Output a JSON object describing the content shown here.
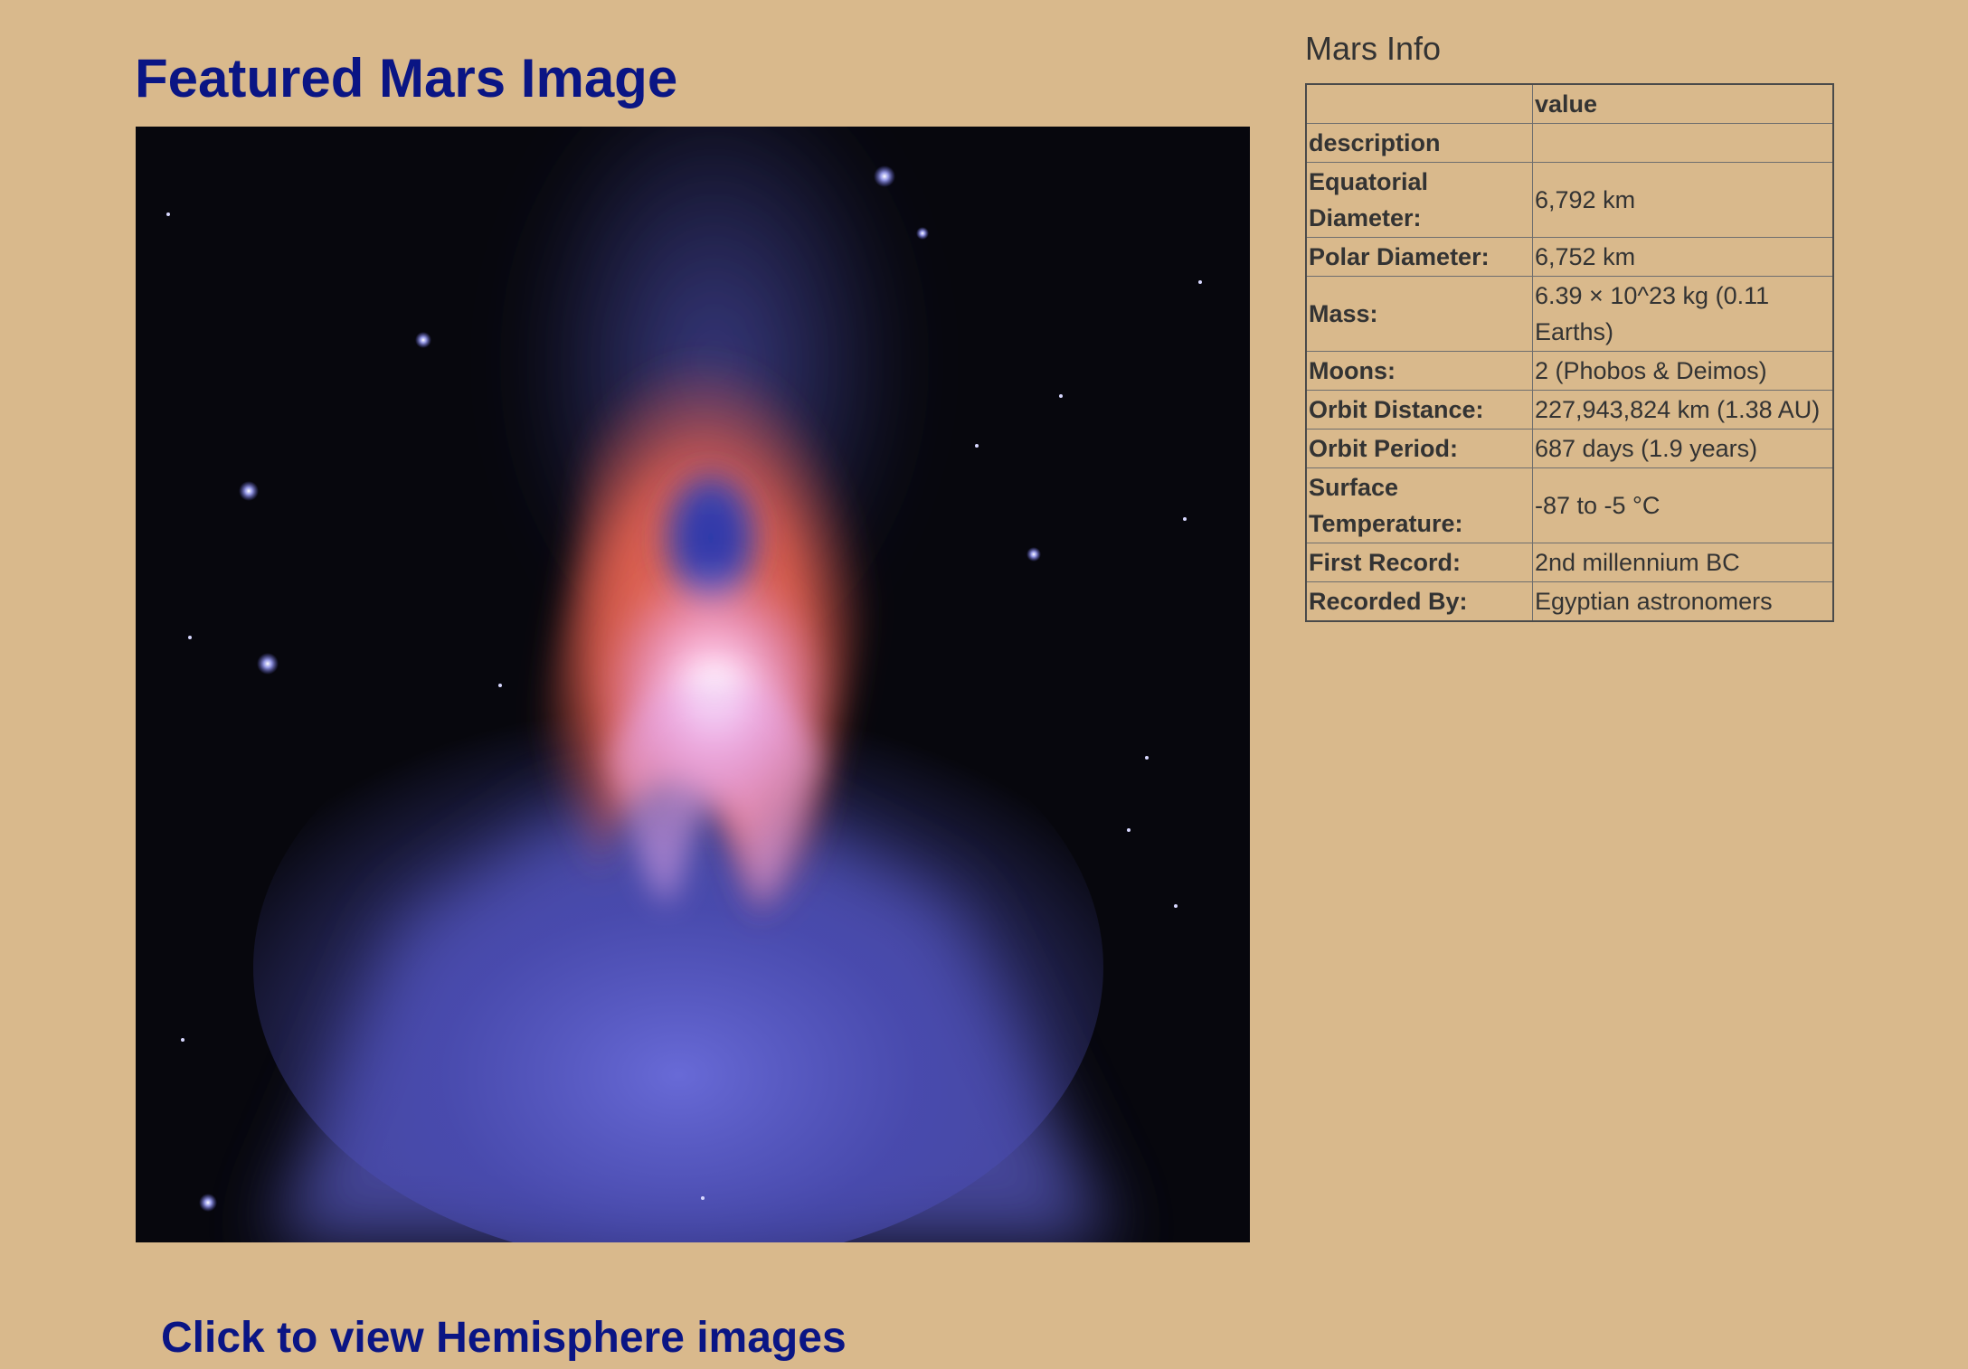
{
  "featured": {
    "title": "Featured Mars Image",
    "image_subject": "nebula-photo"
  },
  "hemisphere": {
    "link_label": "Click to view Hemisphere images"
  },
  "mars_info": {
    "title": "Mars Info",
    "table": {
      "header": [
        "",
        "value"
      ],
      "rows": [
        {
          "label": "description",
          "value": ""
        },
        {
          "label": "Equatorial Diameter:",
          "value": "6,792 km"
        },
        {
          "label": "Polar Diameter:",
          "value": "6,752 km"
        },
        {
          "label": "Mass:",
          "value": "6.39 × 10^23 kg (0.11 Earths)"
        },
        {
          "label": "Moons:",
          "value": "2 (Phobos & Deimos)"
        },
        {
          "label": "Orbit Distance:",
          "value": "227,943,824 km (1.38 AU)"
        },
        {
          "label": "Orbit Period:",
          "value": "687 days (1.9 years)"
        },
        {
          "label": "Surface Temperature:",
          "value": "-87 to -5 °C"
        },
        {
          "label": "First Record:",
          "value": "2nd millennium BC"
        },
        {
          "label": "Recorded By:",
          "value": "Egyptian astronomers"
        }
      ]
    }
  },
  "colors": {
    "background": "#D9B98C",
    "heading": "#0A1584",
    "text": "#333333",
    "table_border": "#6E6E6E"
  }
}
